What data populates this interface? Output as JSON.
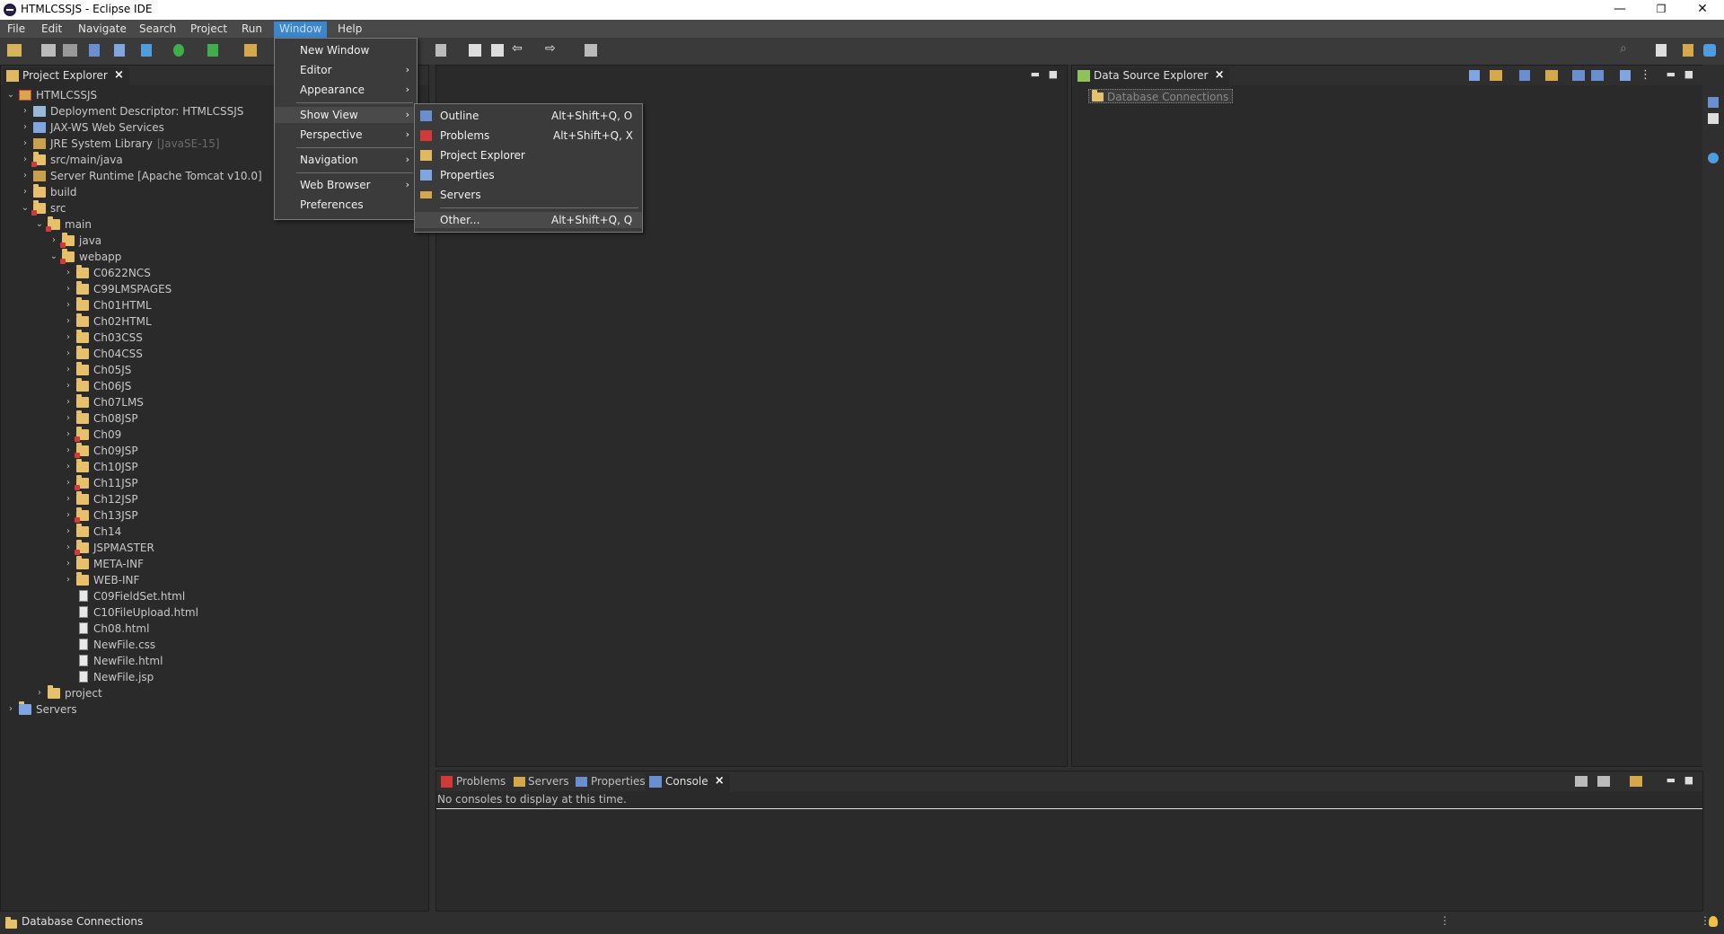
{
  "window": {
    "title": "HTMLCSSJS - Eclipse IDE",
    "minimize": "—",
    "maximize": "❐",
    "close": "✕"
  },
  "menubar": [
    "File",
    "Edit",
    "Navigate",
    "Search",
    "Project",
    "Run",
    "Window",
    "Help"
  ],
  "window_menu": {
    "items": [
      {
        "label": "New Window",
        "submenu": false
      },
      {
        "label": "Editor",
        "submenu": true
      },
      {
        "label": "Appearance",
        "submenu": true
      },
      {
        "label": "Show View",
        "submenu": true
      },
      {
        "label": "Perspective",
        "submenu": true
      },
      {
        "label": "Navigation",
        "submenu": true
      },
      {
        "label": "Web Browser",
        "submenu": true
      },
      {
        "label": "Preferences",
        "submenu": false
      }
    ]
  },
  "show_view_menu": {
    "items": [
      {
        "label": "Outline",
        "shortcut": "Alt+Shift+Q, O"
      },
      {
        "label": "Problems",
        "shortcut": "Alt+Shift+Q, X"
      },
      {
        "label": "Project Explorer",
        "shortcut": ""
      },
      {
        "label": "Properties",
        "shortcut": ""
      },
      {
        "label": "Servers",
        "shortcut": ""
      },
      {
        "label": "Other...",
        "shortcut": "Alt+Shift+Q, Q"
      }
    ]
  },
  "project_explorer": {
    "tab": "Project Explorer",
    "tree": [
      {
        "label": "HTMLCSSJS",
        "indent": 0,
        "twisty": "open",
        "icon": "project"
      },
      {
        "label": "Deployment Descriptor: HTMLCSSJS",
        "indent": 1,
        "twisty": "closed",
        "icon": "descriptor"
      },
      {
        "label": "JAX-WS Web Services",
        "indent": 1,
        "twisty": "closed",
        "icon": "webservice"
      },
      {
        "label": "JRE System Library",
        "extra": "[JavaSE-15]",
        "indent": 1,
        "twisty": "closed",
        "icon": "library"
      },
      {
        "label": "src/main/java",
        "indent": 1,
        "twisty": "closed",
        "icon": "folder-err"
      },
      {
        "label": "Server Runtime [Apache Tomcat v10.0]",
        "indent": 1,
        "twisty": "closed",
        "icon": "library"
      },
      {
        "label": "build",
        "indent": 1,
        "twisty": "closed",
        "icon": "folder"
      },
      {
        "label": "src",
        "indent": 1,
        "twisty": "open",
        "icon": "folder-err"
      },
      {
        "label": "main",
        "indent": 2,
        "twisty": "open",
        "icon": "folder-err"
      },
      {
        "label": "java",
        "indent": 3,
        "twisty": "closed",
        "icon": "folder-err"
      },
      {
        "label": "webapp",
        "indent": 3,
        "twisty": "open",
        "icon": "folder-err"
      },
      {
        "label": "C0622NCS",
        "indent": 4,
        "twisty": "closed",
        "icon": "folder"
      },
      {
        "label": "C99LMSPAGES",
        "indent": 4,
        "twisty": "closed",
        "icon": "folder"
      },
      {
        "label": "Ch01HTML",
        "indent": 4,
        "twisty": "closed",
        "icon": "folder"
      },
      {
        "label": "Ch02HTML",
        "indent": 4,
        "twisty": "closed",
        "icon": "folder"
      },
      {
        "label": "Ch03CSS",
        "indent": 4,
        "twisty": "closed",
        "icon": "folder"
      },
      {
        "label": "Ch04CSS",
        "indent": 4,
        "twisty": "closed",
        "icon": "folder"
      },
      {
        "label": "Ch05JS",
        "indent": 4,
        "twisty": "closed",
        "icon": "folder"
      },
      {
        "label": "Ch06JS",
        "indent": 4,
        "twisty": "closed",
        "icon": "folder"
      },
      {
        "label": "Ch07LMS",
        "indent": 4,
        "twisty": "closed",
        "icon": "folder"
      },
      {
        "label": "Ch08JSP",
        "indent": 4,
        "twisty": "closed",
        "icon": "folder"
      },
      {
        "label": "Ch09",
        "indent": 4,
        "twisty": "closed",
        "icon": "folder-err"
      },
      {
        "label": "Ch09JSP",
        "indent": 4,
        "twisty": "closed",
        "icon": "folder-err"
      },
      {
        "label": "Ch10JSP",
        "indent": 4,
        "twisty": "closed",
        "icon": "folder"
      },
      {
        "label": "Ch11JSP",
        "indent": 4,
        "twisty": "closed",
        "icon": "folder-err"
      },
      {
        "label": "Ch12JSP",
        "indent": 4,
        "twisty": "closed",
        "icon": "folder"
      },
      {
        "label": "Ch13JSP",
        "indent": 4,
        "twisty": "closed",
        "icon": "folder-err"
      },
      {
        "label": "Ch14",
        "indent": 4,
        "twisty": "closed",
        "icon": "folder"
      },
      {
        "label": "JSPMASTER",
        "indent": 4,
        "twisty": "closed",
        "icon": "folder-err"
      },
      {
        "label": "META-INF",
        "indent": 4,
        "twisty": "closed",
        "icon": "folder"
      },
      {
        "label": "WEB-INF",
        "indent": 4,
        "twisty": "closed",
        "icon": "folder"
      },
      {
        "label": "C09FieldSet.html",
        "indent": 4,
        "twisty": "none",
        "icon": "file"
      },
      {
        "label": "C10FileUpload.html",
        "indent": 4,
        "twisty": "none",
        "icon": "file"
      },
      {
        "label": "Ch08.html",
        "indent": 4,
        "twisty": "none",
        "icon": "file"
      },
      {
        "label": "NewFile.css",
        "indent": 4,
        "twisty": "none",
        "icon": "file"
      },
      {
        "label": "NewFile.html",
        "indent": 4,
        "twisty": "none",
        "icon": "file"
      },
      {
        "label": "NewFile.jsp",
        "indent": 4,
        "twisty": "none",
        "icon": "file"
      },
      {
        "label": "project",
        "indent": 2,
        "twisty": "closed",
        "icon": "folder"
      },
      {
        "label": "Servers",
        "indent": 0,
        "twisty": "closed",
        "icon": "folder-blue"
      }
    ]
  },
  "data_source_explorer": {
    "tab": "Data Source Explorer",
    "item": "Database Connections"
  },
  "bottom_panel": {
    "tabs": [
      "Problems",
      "Servers",
      "Properties",
      "Console"
    ],
    "active": "Console",
    "message": "No consoles to display at this time."
  },
  "statusbar": {
    "text": "Database Connections"
  }
}
